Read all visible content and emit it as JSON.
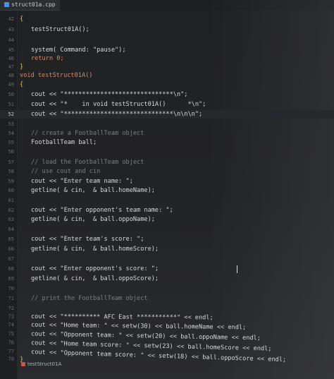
{
  "tab": {
    "title": "struct01a.cpp"
  },
  "status": {
    "label": "testStruct01A"
  },
  "lines": [
    {
      "n": "42",
      "code": "{"
    },
    {
      "n": "43",
      "code": "testStruct01A();"
    },
    {
      "n": "44",
      "code": ""
    },
    {
      "n": "45",
      "code": "system( Command: \"pause\");"
    },
    {
      "n": "46",
      "code": "return 0;"
    },
    {
      "n": "47",
      "code": "}"
    },
    {
      "n": "48",
      "code": "void testStruct01A()"
    },
    {
      "n": "49",
      "code": "{"
    },
    {
      "n": "50",
      "code": "cout << \"******************************\\n\";"
    },
    {
      "n": "51",
      "code": "cout << \"*    in void testStruct01A()      *\\n\";"
    },
    {
      "n": "52",
      "code": "cout << \"******************************\\n\\n\\n\";"
    },
    {
      "n": "53",
      "code": ""
    },
    {
      "n": "54",
      "code": "// create a FootballTeam object"
    },
    {
      "n": "55",
      "code": "FootballTeam ball;"
    },
    {
      "n": "56",
      "code": ""
    },
    {
      "n": "57",
      "code": "// load the FootballTeam object"
    },
    {
      "n": "58",
      "code": "// use cout and cin"
    },
    {
      "n": "59",
      "code": "cout << \"Enter team name: \";"
    },
    {
      "n": "60",
      "code": "getline( & cin,  & ball.homeName);"
    },
    {
      "n": "61",
      "code": ""
    },
    {
      "n": "62",
      "code": "cout << \"Enter opponent's team name: \";"
    },
    {
      "n": "63",
      "code": "getline( & cin,  & ball.oppoName);"
    },
    {
      "n": "64",
      "code": ""
    },
    {
      "n": "65",
      "code": "cout << \"Enter team's score: \";"
    },
    {
      "n": "66",
      "code": "getline( & cin,  & ball.homeScore);"
    },
    {
      "n": "67",
      "code": ""
    },
    {
      "n": "68",
      "code": "cout << \"Enter opponent's score: \";"
    },
    {
      "n": "69",
      "code": "getline( & cin,  & ball.oppoScore);"
    },
    {
      "n": "70",
      "code": ""
    },
    {
      "n": "71",
      "code": "// print the FootballTeam object"
    },
    {
      "n": "72",
      "code": ""
    },
    {
      "n": "73",
      "code": "cout << \"********** AFC East ***********\" << endl;"
    },
    {
      "n": "74",
      "code": "cout << \"Home team: \" << setw(30) << ball.homeName << endl;"
    },
    {
      "n": "75",
      "code": "cout << \"Opponent team: \" << setw(20) << ball.oppoName << endl;"
    },
    {
      "n": "76",
      "code": "cout << \"Home team score: \" << setw(23) << ball.homeScore << endl;"
    },
    {
      "n": "77",
      "code": "cout << \"Opponent team score: \" << setw(18) << ball.oppoScore << endl;"
    },
    {
      "n": "78",
      "code": "}"
    }
  ]
}
